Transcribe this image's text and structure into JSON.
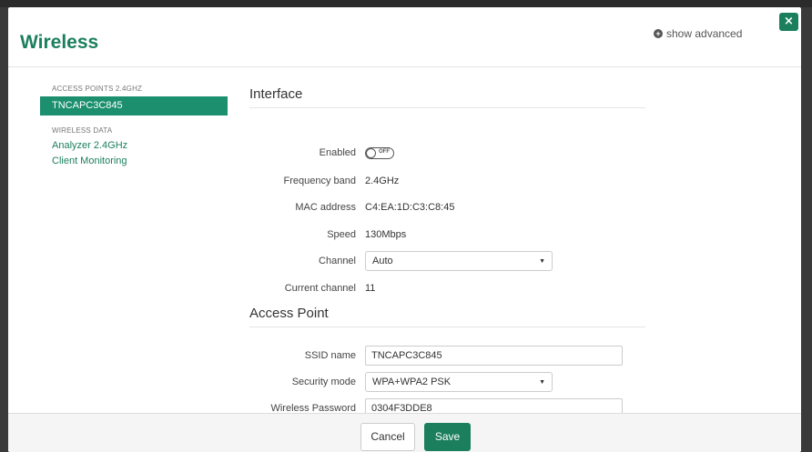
{
  "modal": {
    "title": "Wireless",
    "show_advanced": "show advanced",
    "close_glyph": "×"
  },
  "sidebar": {
    "access_points_heading": "ACCESS POINTS 2.4GHZ",
    "active_item": "TNCAPC3C845",
    "wireless_data_heading": "WIRELESS DATA",
    "links": [
      "Analyzer 2.4GHz",
      "Client Monitoring"
    ]
  },
  "interface": {
    "section_title": "Interface",
    "enabled_label": "Enabled",
    "toggle_text": "OFF",
    "frequency_label": "Frequency band",
    "frequency_value": "2.4GHz",
    "mac_label": "MAC address",
    "mac_value": "C4:EA:1D:C3:C8:45",
    "speed_label": "Speed",
    "speed_value": "130Mbps",
    "channel_label": "Channel",
    "channel_value": "Auto",
    "current_channel_label": "Current channel",
    "current_channel_value": "11"
  },
  "access_point": {
    "section_title": "Access Point",
    "ssid_label": "SSID name",
    "ssid_value": "TNCAPC3C845",
    "security_label": "Security mode",
    "security_value": "WPA+WPA2 PSK",
    "password_label": "Wireless Password",
    "password_value": "0304F3DDE8"
  },
  "footer": {
    "cancel_label": "Cancel",
    "save_label": "Save"
  },
  "colors": {
    "accent": "#1b7f5e",
    "active_item_bg": "#1b8f6e"
  },
  "icons": {
    "show_advanced": "plus-circle-icon",
    "close": "close-icon",
    "select_caret": "caret-down-icon"
  }
}
